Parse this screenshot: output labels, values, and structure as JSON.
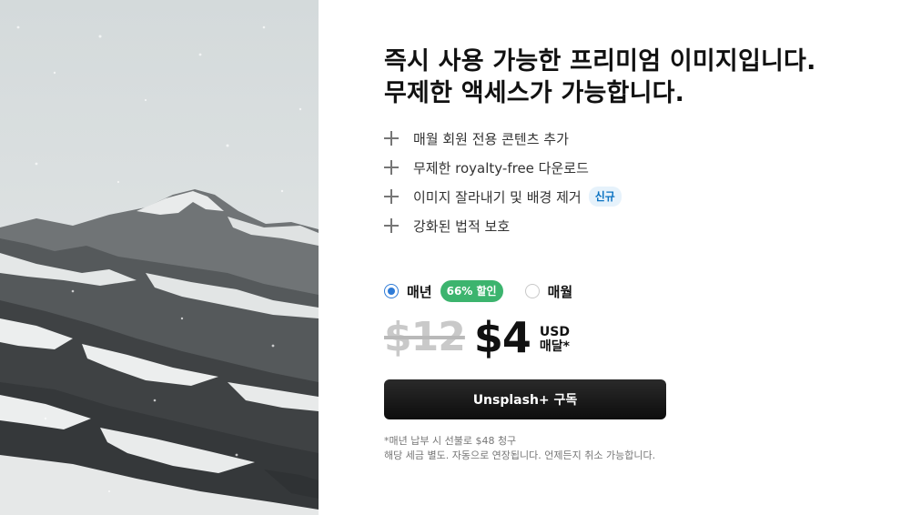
{
  "hero": {
    "image_name": "snowy-mountain-photo",
    "colors": {
      "sky": "#d9dedf",
      "rock": "#4a4d4f",
      "snow": "#eceeee"
    }
  },
  "headline": {
    "line1": "즉시 사용 가능한 프리미엄 이미지입니다.",
    "line2": "무제한 액세스가 가능합니다."
  },
  "features": [
    {
      "icon": "plus-icon",
      "label": "매월 회원 전용 콘텐츠 추가"
    },
    {
      "icon": "plus-icon",
      "label": "무제한 royalty-free 다운로드"
    },
    {
      "icon": "plus-icon",
      "label": "이미지 잘라내기 및 배경 제거",
      "badge": "신규"
    },
    {
      "icon": "plus-icon",
      "label": "강화된 법적 보호"
    }
  ],
  "plans": {
    "yearly": {
      "label": "매년",
      "discount": "66% 할인",
      "selected": true
    },
    "monthly": {
      "label": "매월",
      "selected": false
    }
  },
  "price": {
    "old": "$12",
    "current": "$4",
    "currency": "USD",
    "period": "매달*"
  },
  "subscribe": {
    "label": "Unsplash+ 구독"
  },
  "fineprint": {
    "line1": "*매년 납부 시 선불로 $48 청구",
    "line2": "해당 세금 별도. 자동으로 연장됩니다. 언제든지 취소 가능합니다."
  },
  "colors": {
    "accent": "#2e7bd7",
    "discount_green": "#3cb46e",
    "new_badge_bg": "#e6f2fb",
    "new_badge_text": "#0a72c2",
    "button": "#111111"
  }
}
